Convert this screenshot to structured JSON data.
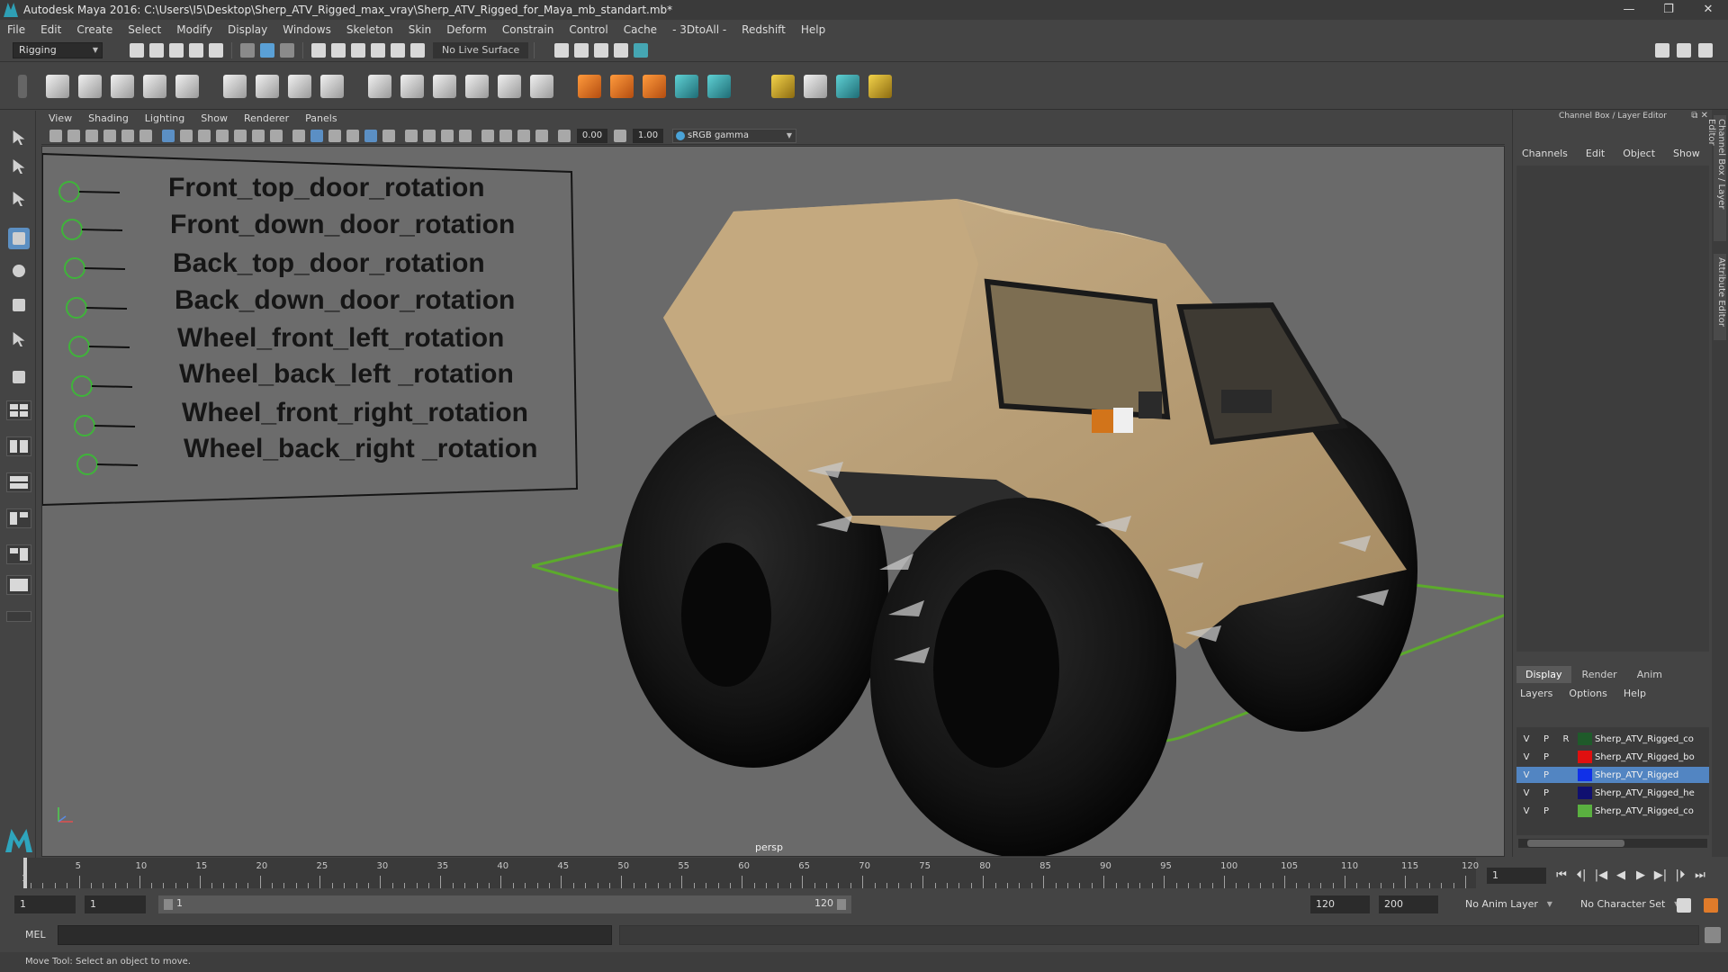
{
  "window": {
    "title": "Autodesk Maya 2016: C:\\Users\\I5\\Desktop\\Sherp_ATV_Rigged_max_vray\\Sherp_ATV_Rigged_for_Maya_mb_standart.mb*",
    "controls": [
      "—",
      "❐",
      "✕"
    ]
  },
  "menubar": [
    "File",
    "Edit",
    "Create",
    "Select",
    "Modify",
    "Display",
    "Windows",
    "Skeleton",
    "Skin",
    "Deform",
    "Constrain",
    "Control",
    "Cache",
    "- 3DtoAll -",
    "Redshift",
    "Help"
  ],
  "statusline": {
    "mode": "Rigging",
    "live_surface": "No Live Surface"
  },
  "viewport": {
    "menu": [
      "View",
      "Shading",
      "Lighting",
      "Show",
      "Renderer",
      "Panels"
    ],
    "exposure": "0.00",
    "gamma": "1.00",
    "color_space": "sRGB gamma",
    "camera": "persp",
    "rig_controls": [
      "Front_top_door_rotation",
      "Front_down_door_rotation",
      "Back_top_door_rotation",
      "Back_down_door_rotation",
      "Wheel_front_left_rotation",
      "Wheel_back_left _rotation",
      "Wheel_front_right_rotation",
      "Wheel_back_right _rotation"
    ]
  },
  "channel_box": {
    "title": "Channel Box / Layer Editor",
    "menu": [
      "Channels",
      "Edit",
      "Object",
      "Show"
    ],
    "tabs": [
      "Display",
      "Render",
      "Anim"
    ],
    "active_tab": "Display",
    "layer_menu": [
      "Layers",
      "Options",
      "Help"
    ],
    "layers": [
      {
        "v": "V",
        "p": "P",
        "r": "R",
        "color": "#1f5a2a",
        "name": "Sherp_ATV_Rigged_co"
      },
      {
        "v": "V",
        "p": "P",
        "r": "",
        "color": "#e01010",
        "name": "Sherp_ATV_Rigged_bo"
      },
      {
        "v": "V",
        "p": "P",
        "r": "",
        "color": "#1030e8",
        "name": "Sherp_ATV_Rigged",
        "selected": true
      },
      {
        "v": "V",
        "p": "P",
        "r": "",
        "color": "#101070",
        "name": "Sherp_ATV_Rigged_he"
      },
      {
        "v": "V",
        "p": "P",
        "r": "",
        "color": "#5ab040",
        "name": "Sherp_ATV_Rigged_co"
      }
    ]
  },
  "side_tabs": [
    "Channel Box / Layer Editor",
    "Attribute Editor"
  ],
  "timeslider": {
    "labels": [
      "5",
      "10",
      "15",
      "20",
      "25",
      "30",
      "35",
      "40",
      "45",
      "50",
      "55",
      "60",
      "65",
      "70",
      "75",
      "80",
      "85",
      "90",
      "95",
      "100",
      "105",
      "110",
      "115",
      "120"
    ],
    "start_label": "1",
    "current_frame": "1",
    "playback": [
      "⏮",
      "⏴|",
      "|◀",
      "◀",
      "▶",
      "▶|",
      "|⏵",
      "⏭"
    ]
  },
  "range": {
    "start": "1",
    "start_inner": "1",
    "range_lo": "1",
    "range_hi": "120",
    "end_inner": "120",
    "end": "200",
    "anim_layer": "No Anim Layer",
    "character_set": "No Character Set"
  },
  "cmdline": {
    "language": "MEL"
  },
  "helpline": "Move Tool: Select an object to move."
}
